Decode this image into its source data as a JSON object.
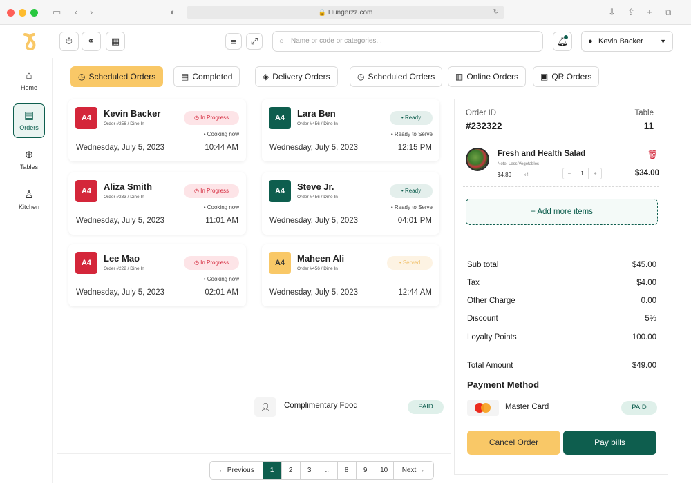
{
  "browser": {
    "url": "Hungerzz.com"
  },
  "colors": {
    "primary": "#0e5e4e",
    "accent": "#f9c867",
    "danger": "#d4263a"
  },
  "toolbar": {
    "search_placeholder": "Name or code or categories...",
    "user_name": "Kevin Backer"
  },
  "sidebar": {
    "items": [
      {
        "label": "Home",
        "icon": "home-icon"
      },
      {
        "label": "Orders",
        "icon": "orders-icon"
      },
      {
        "label": "Tables",
        "icon": "tables-icon"
      },
      {
        "label": "Kitchen",
        "icon": "kitchen-icon"
      }
    ]
  },
  "tabs": [
    {
      "label": "Scheduled Orders",
      "icon": "timer-icon"
    },
    {
      "label": "Completed",
      "icon": "clipboard-icon"
    },
    {
      "label": "Delivery Orders",
      "icon": "package-icon"
    },
    {
      "label": "Scheduled Orders",
      "icon": "clock-icon"
    },
    {
      "label": "Online Orders",
      "icon": "online-icon"
    },
    {
      "label": "QR Orders",
      "icon": "qr-icon"
    }
  ],
  "orders": [
    {
      "table": "A4",
      "name": "Kevin Backer",
      "sub": "Order #256 / Dine In",
      "status": "In Progress",
      "note": "• Cooking now",
      "date": "Wednesday, July 5, 2023",
      "time": "10:44 AM"
    },
    {
      "table": "A4",
      "name": "Lara Ben",
      "sub": "Order #456 / Dine In",
      "status": "• Ready",
      "note": "• Ready to Serve",
      "date": "Wednesday, July 5, 2023",
      "time": "12:15 PM"
    },
    {
      "table": "A4",
      "name": "Aliza Smith",
      "sub": "Order #233 / Dine In",
      "status": "In Progress",
      "note": "• Cooking now",
      "date": "Wednesday, July 5, 2023",
      "time": "11:01 AM"
    },
    {
      "table": "A4",
      "name": "Steve Jr.",
      "sub": "Order #456 / Dine In",
      "status": "• Ready",
      "note": "• Ready to Serve",
      "date": "Wednesday, July 5, 2023",
      "time": "04:01 PM"
    },
    {
      "table": "A4",
      "name": "Lee Mao",
      "sub": "Order #222 / Dine In",
      "status": "In Progress",
      "note": "• Cooking now",
      "date": "Wednesday, July 5, 2023",
      "time": "02:01 AM"
    },
    {
      "table": "A4",
      "name": "Maheen Ali",
      "sub": "Order #456 / Dine In",
      "status": "• Served",
      "note": "",
      "date": "Wednesday, July 5, 2023",
      "time": "12:44 AM"
    }
  ],
  "complimentary": {
    "label": "Complimentary Food",
    "status": "PAID"
  },
  "pagination": {
    "previous": "Previous",
    "next": "Next",
    "pages": [
      "1",
      "2",
      "3",
      "...",
      "8",
      "9",
      "10"
    ],
    "current": "1"
  },
  "panel": {
    "order_id_label": "Order ID",
    "order_id": "#232322",
    "table_label": "Table",
    "table": "11",
    "item": {
      "name": "Fresh and Health Salad",
      "note": "Note: Less Vegetables",
      "price": "$4.89",
      "qty_label": "x4",
      "qty": "1",
      "total": "$34.00"
    },
    "add_more": "+ Add more items",
    "summary": [
      {
        "label": "Sub total",
        "value": "$45.00"
      },
      {
        "label": "Tax",
        "value": "$4.00"
      },
      {
        "label": "Other Charge",
        "value": "0.00"
      },
      {
        "label": "Discount",
        "value": "5%"
      },
      {
        "label": "Loyalty Points",
        "value": "100.00"
      }
    ],
    "total_label": "Total Amount",
    "total_value": "$49.00",
    "payment_title": "Payment Method",
    "payment_method": "Master Card",
    "payment_status": "PAID",
    "cancel": "Cancel Order",
    "pay": "Pay bills"
  }
}
